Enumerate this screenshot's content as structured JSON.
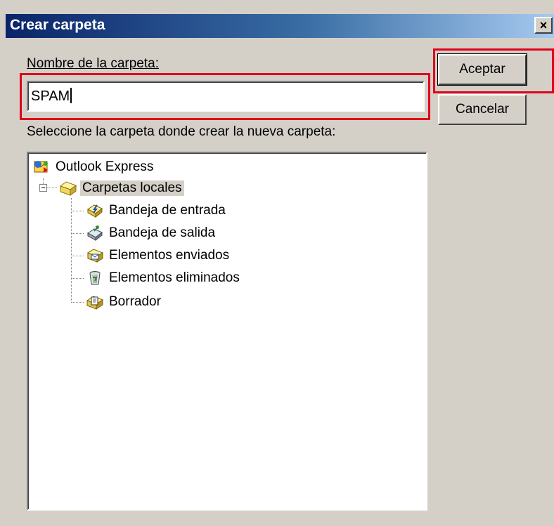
{
  "window": {
    "title": "Crear carpeta",
    "close_glyph": "×"
  },
  "form": {
    "name_label": "Nombre de la carpeta:",
    "name_value": "SPAM",
    "location_label": "Seleccione la carpeta donde crear la nueva carpeta:"
  },
  "buttons": {
    "accept": "Aceptar",
    "cancel": "Cancelar"
  },
  "tree": {
    "root": {
      "label": "Outlook Express",
      "icon": "outlook-express-icon"
    },
    "local": {
      "label": "Carpetas locales",
      "icon": "local-folders-icon",
      "expanded": true,
      "selected": true
    },
    "children": [
      {
        "label": "Bandeja de entrada",
        "icon": "inbox-icon"
      },
      {
        "label": "Bandeja de salida",
        "icon": "outbox-icon"
      },
      {
        "label": "Elementos enviados",
        "icon": "sent-items-icon"
      },
      {
        "label": "Elementos eliminados",
        "icon": "deleted-items-icon"
      },
      {
        "label": "Borrador",
        "icon": "drafts-icon"
      }
    ]
  },
  "highlight_color": "#e0001b"
}
